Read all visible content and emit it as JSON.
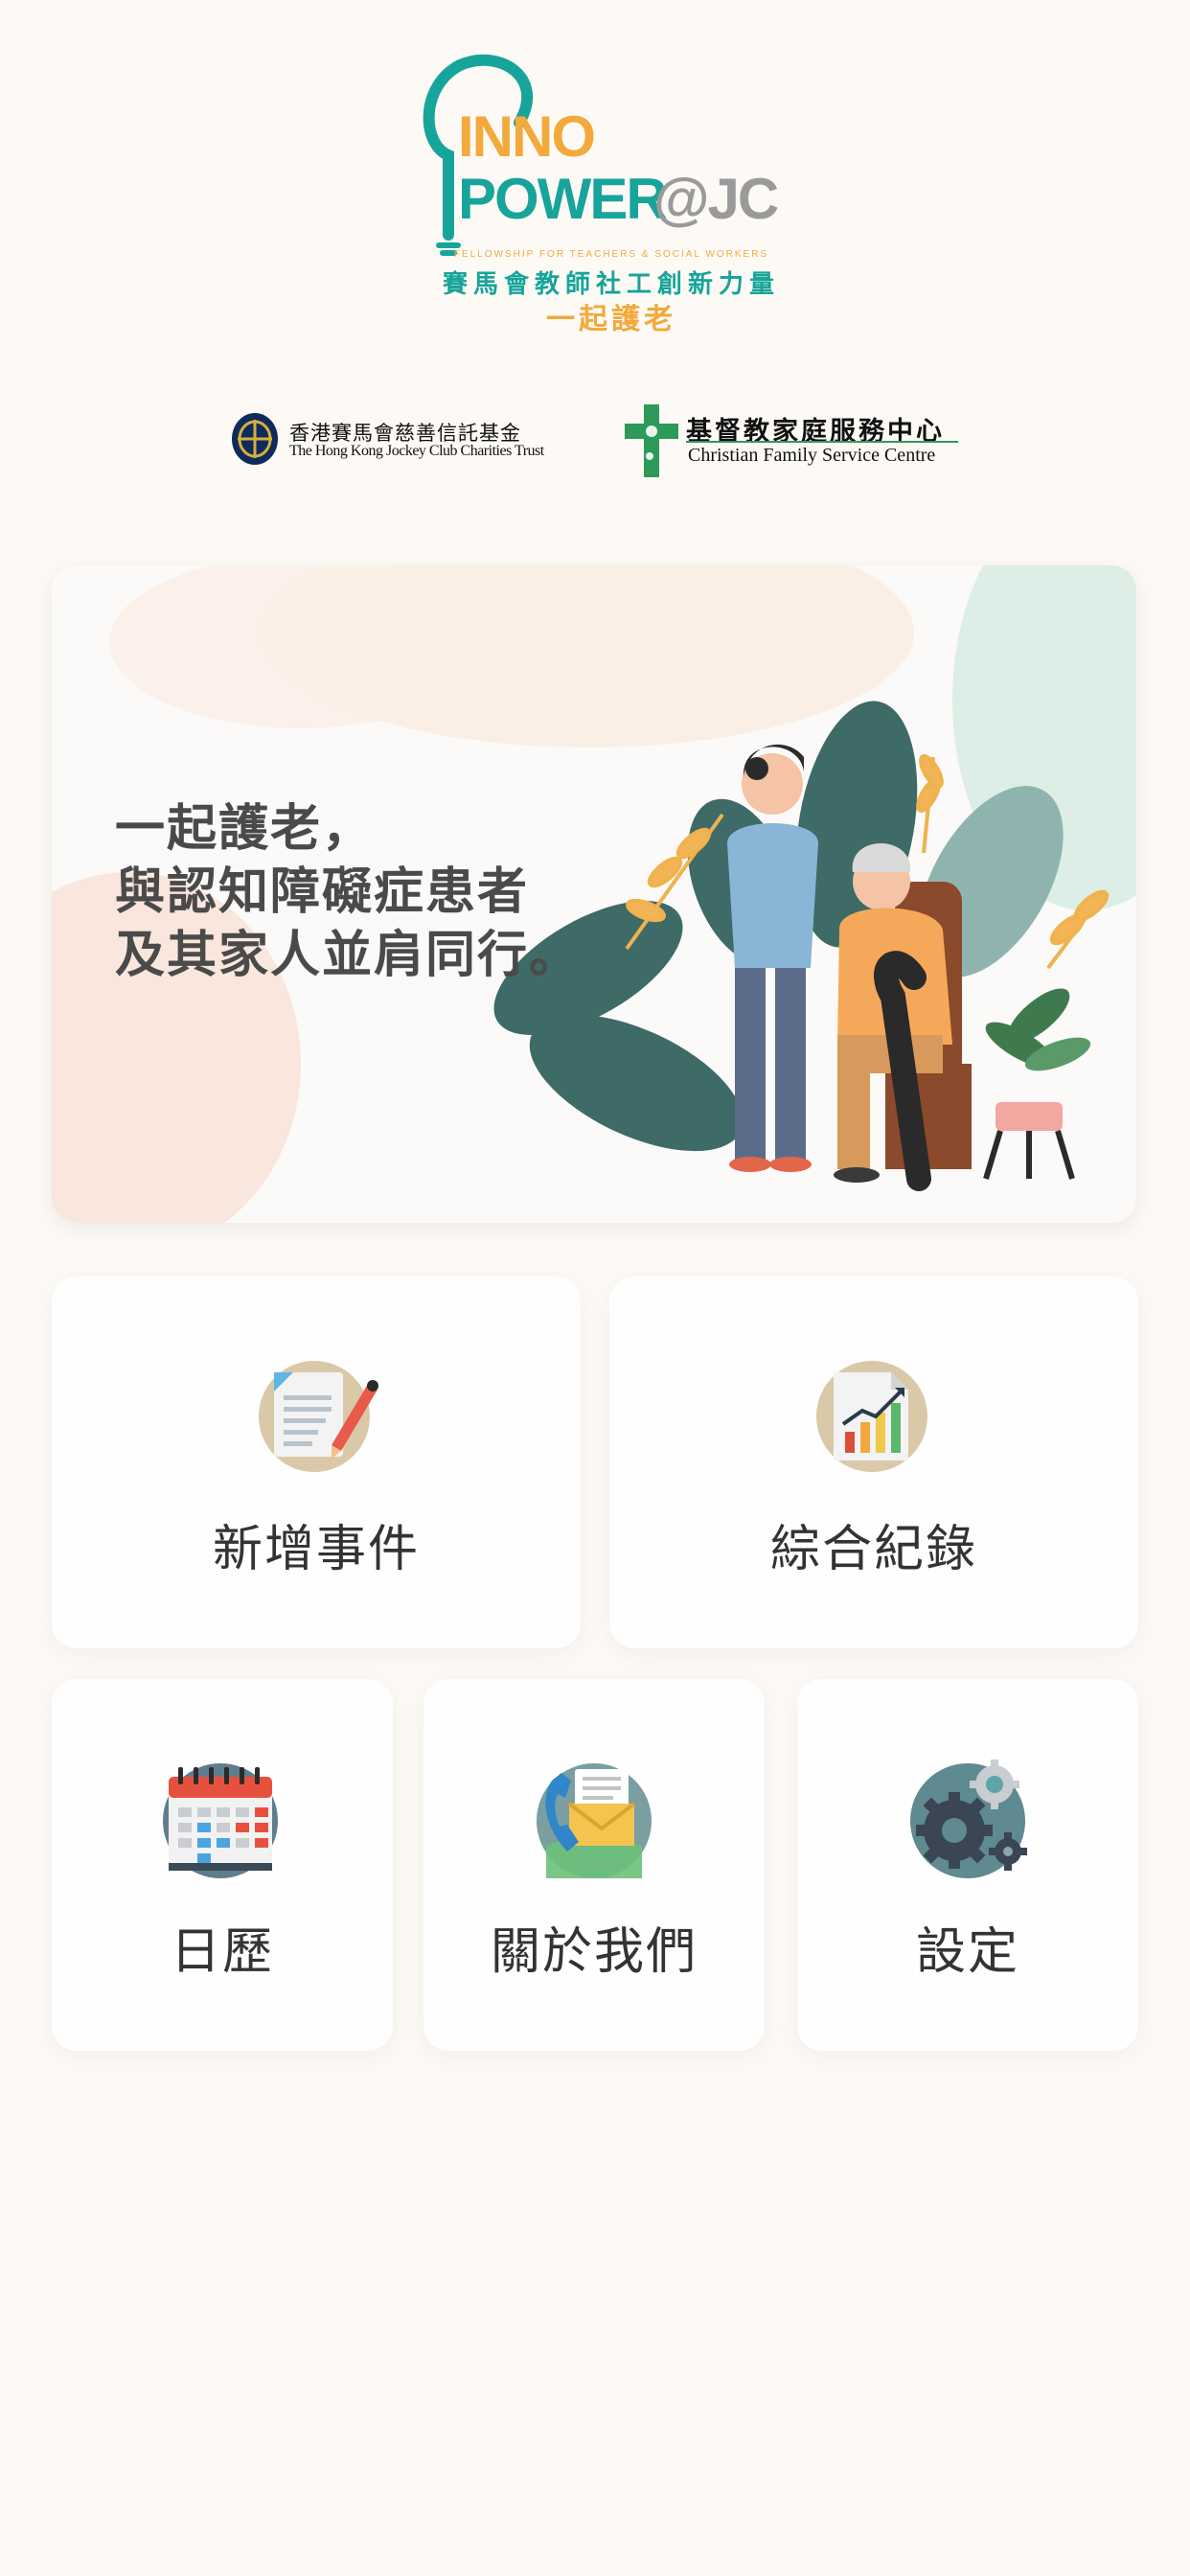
{
  "app": {
    "logo": {
      "inno": "INNO",
      "power": "POWER",
      "at_jc": "@JC",
      "fellowship": "FELLOWSHIP FOR TEACHERS & SOCIAL WORKERS",
      "chinese_name": "賽馬會教師社工創新力量",
      "tagline": "一起護老"
    },
    "partners": {
      "jockey_club_cn": "香港賽馬會慈善信託基金",
      "jockey_club_en": "The Hong Kong Jockey Club Charities Trust",
      "cfsc_cn": "基督教家庭服務中心",
      "cfsc_en": "Christian Family Service Centre"
    }
  },
  "banner": {
    "lines": [
      "一起護老，",
      "與認知障礙症患者",
      "及其家人並肩同行。"
    ]
  },
  "menu": {
    "add_event": {
      "label": "新增事件",
      "icon": "document-pencil-icon"
    },
    "records": {
      "label": "綜合紀錄",
      "icon": "report-chart-icon"
    },
    "calendar": {
      "label": "日歷",
      "icon": "calendar-icon"
    },
    "about": {
      "label": "關於我們",
      "icon": "contact-phone-mail-icon"
    },
    "settings": {
      "label": "設定",
      "icon": "gears-icon"
    }
  },
  "colors": {
    "teal": "#17a49a",
    "orange": "#f3a93c",
    "grey": "#9a9a9a",
    "background": "#fdfaf6"
  }
}
